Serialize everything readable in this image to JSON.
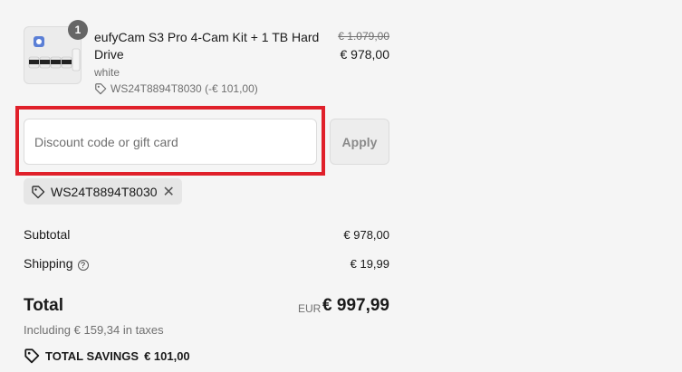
{
  "product": {
    "quantity": "1",
    "title": "eufyCam S3 Pro 4-Cam Kit + 1 TB Hard Drive",
    "variant": "white",
    "discount_line": "WS24T8894T8030 (-€ 101,00)",
    "price_original": "€ 1.079,00",
    "price_current": "€ 978,00"
  },
  "discount": {
    "placeholder": "Discount code or gift card",
    "value": "",
    "apply_label": "Apply",
    "applied_code": "WS24T8894T8030"
  },
  "summary": {
    "subtotal_label": "Subtotal",
    "subtotal_value": "€ 978,00",
    "shipping_label": "Shipping",
    "shipping_value": "€ 19,99",
    "total_label": "Total",
    "currency": "EUR",
    "total_value": "€ 997,99",
    "taxes_note": "Including € 159,34 in taxes",
    "savings_label": "TOTAL SAVINGS",
    "savings_value": "€ 101,00"
  },
  "colors": {
    "highlight": "#e0202a",
    "background": "#f5f5f5"
  }
}
